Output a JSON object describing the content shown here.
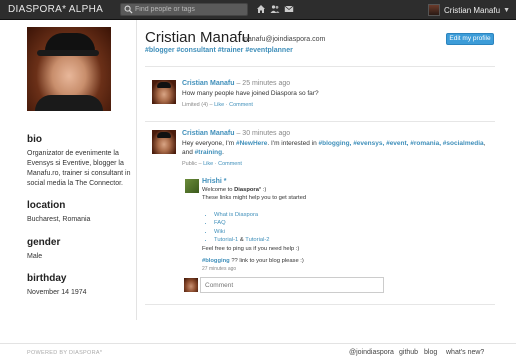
{
  "topbar": {
    "brand": "DIASPORA* ALPHA",
    "search_placeholder": "Find people or tags",
    "user_name": "Cristian Manafu",
    "icons": [
      "home-icon",
      "people-icon",
      "mail-icon",
      "search-icon",
      "chevron-down-icon"
    ]
  },
  "profile": {
    "name": "Cristian Manafu",
    "handle": "manafu@joindiaspora.com",
    "tags": "#blogger #consultant #trainer #eventplanner",
    "edit_label": "Edit my profile",
    "bio_heading": "bio",
    "bio_text": "Organizator de evenimente la Evensys si Eventive, blogger la Manafu.ro, trainer si consultant in social media la The Connector.",
    "location_heading": "location",
    "location_text": "Bucharest, Romania",
    "gender_heading": "gender",
    "gender_text": "Male",
    "birthday_heading": "birthday",
    "birthday_text": "November 14 1974"
  },
  "posts": [
    {
      "author": "Cristian Manafu",
      "time": " – 25 minutes ago",
      "text": "How many people have joined Diaspora so far?",
      "meta_vis": "Limited (4)",
      "meta_like": "Like",
      "meta_comment": "Comment"
    },
    {
      "author": "Cristian Manafu",
      "time": " – 30 minutes ago",
      "text_line1_pre": "Hey everyone, I'm ",
      "tag_new": "#NewHere",
      "text_line1_mid": ". I'm interested in ",
      "tags_line1": "#blogging, #evensys, #event, #romania, #socialmedia",
      "text_line1_end": ", and",
      "tag_training": "#training",
      "text_line2_end": ".",
      "meta_vis": "Public",
      "meta_like": "Like",
      "meta_comment": "Comment"
    }
  ],
  "comment": {
    "author": "Hrishi *",
    "welcome_pre": "Welcome to ",
    "welcome_brand": "Diaspora",
    "welcome_post": "* :)",
    "intro": "These links might help you to get started",
    "links": [
      "What is Diaspora",
      "FAQ",
      "Wiki"
    ],
    "tutorial_1": "Tutorial-1",
    "tutorial_and": " & ",
    "tutorial_2": "Tutorial-2",
    "outro": "Feel free to ping us if you need help :)",
    "tag_blogging": "#blogging",
    "blogging_text": " ?? link to your blog please :)",
    "time": "27 minutes ago"
  },
  "comment_box": {
    "placeholder": "Comment"
  },
  "footer": {
    "powered": "POWERED BY DIASPORA*",
    "links": [
      "@joindiaspora",
      "github",
      "blog",
      "what's new?"
    ]
  }
}
